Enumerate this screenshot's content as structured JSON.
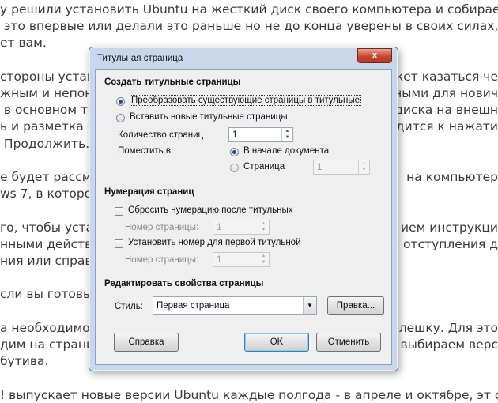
{
  "background": {
    "lines": [
      {
        "text": "у решили установить Ubuntu на жесткий диск своего компьютера и собираетес",
        "align": "left"
      },
      {
        "text": " это впервые или делали это раньше но не до конца уверены в своих силах, эта стат",
        "align": "left"
      },
      {
        "text": "ет вам.",
        "align": "left"
      },
      {
        "text": "",
        "align": "left"
      },
      {
        "text": "стороны устано",
        "align": "left",
        "right": "ожет казаться че"
      },
      {
        "text": "жным и непоня",
        "align": "left",
        "right": "ными для нович"
      },
      {
        "text": " в основном то",
        "align": "left",
        "right": "о диска на внешн"
      },
      {
        "text": "ь и разметка ж",
        "align": "left",
        "right": "водится к нажати"
      },
      {
        "text": " Продолжить.",
        "align": "left"
      },
      {
        "text": "",
        "align": "left"
      },
      {
        "text": "е будет рассм",
        "align": "left",
        "right": "на компьютер"
      },
      {
        "text": "ws 7, в котором б",
        "align": "left"
      },
      {
        "text": "",
        "align": "left"
      },
      {
        "text": "го, чтобы устан",
        "align": "left",
        "right": "ием инструкци"
      },
      {
        "text": "нными действи",
        "align": "left",
        "right": "ь отступления д"
      },
      {
        "text": "ния или справки",
        "align": "left"
      },
      {
        "text": "",
        "align": "left"
      },
      {
        "text": "сли вы готовы, д",
        "align": "left"
      },
      {
        "text": "",
        "align": "left"
      },
      {
        "text": "а необходимо с",
        "align": "left",
        "right": "флешку. Для это"
      },
      {
        "text": "дим на страни",
        "align": "left",
        "right": "выбираем верс"
      },
      {
        "text": "бутива.",
        "align": "left"
      },
      {
        "text": "",
        "align": "left"
      },
      {
        "text": "! выпускает новые версии Ubuntu каждые полгода - в апреле и октябре, эт стат",
        "align": "left"
      }
    ]
  },
  "dialog": {
    "title": "Титульная страница",
    "close_symbol": "x",
    "create_section": {
      "heading": "Создать титульные страницы",
      "option_convert": "Преобразовать существующие страницы в титульные",
      "option_insert": "Вставить новые титульные страницы",
      "count_label": "Количество страниц",
      "count_value": "1",
      "place_label": "Поместить в",
      "place_start": "В начале документа",
      "place_page": "Страница",
      "page_value": "1"
    },
    "numbering_section": {
      "heading": "Нумерация страниц",
      "reset_label": "Сбросить нумерацию после титульных",
      "reset_page_label": "Номер страницы:",
      "reset_page_value": "1",
      "set_label": "Установить номер для первой титульной",
      "set_page_label": "Номер страницы:",
      "set_page_value": "1"
    },
    "props_section": {
      "heading": "Редактировать свойства страницы",
      "style_label": "Стиль:",
      "style_value": "Первая страница",
      "edit_button": "Правка..."
    },
    "buttons": {
      "help": "Справка",
      "ok": "OK",
      "cancel": "Отменить"
    }
  }
}
